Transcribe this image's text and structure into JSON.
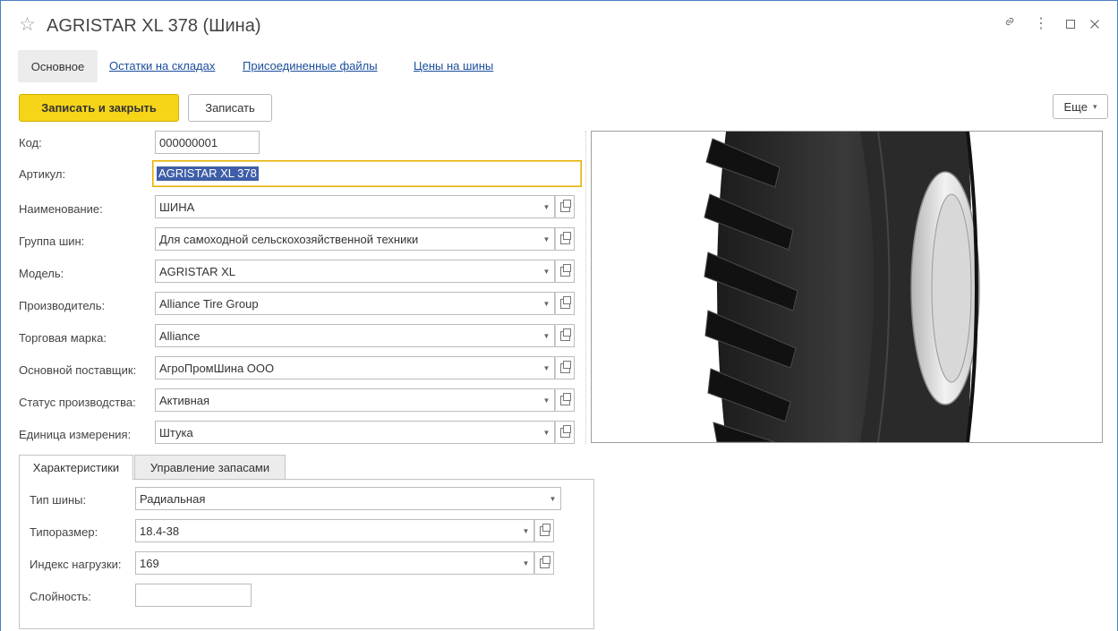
{
  "window": {
    "title": "AGRISTAR XL 378 (Шина)",
    "star_icon": "star-outline-icon",
    "controls": [
      "link-icon",
      "more-vertical-icon",
      "maximize-icon",
      "close-icon"
    ]
  },
  "tabs": {
    "main": "Основное",
    "stock": "Остатки на складах",
    "files": "Присоединенные файлы",
    "prices": "Цены на шины"
  },
  "toolbar": {
    "save_close": "Записать и закрыть",
    "save": "Записать",
    "more": "Еще",
    "more_arrow": "▾"
  },
  "form": {
    "code": {
      "label": "Код:",
      "value": "000000001"
    },
    "article": {
      "label": "Артикул:",
      "value": "AGRISTAR XL 378"
    },
    "name": {
      "label": "Наименование:",
      "value": "ШИНА"
    },
    "group": {
      "label": "Группа шин:",
      "value": "Для самоходной сельскохозяйственной техники"
    },
    "model": {
      "label": "Модель:",
      "value": "AGRISTAR XL"
    },
    "manufacturer": {
      "label": "Производитель:",
      "value": "Alliance Tire Group"
    },
    "brand": {
      "label": "Торговая марка:",
      "value": "Alliance"
    },
    "supplier": {
      "label": "Основной поставщик:",
      "value": "АгроПромШина ООО"
    },
    "status": {
      "label": "Статус производства:",
      "value": "Активная"
    },
    "unit": {
      "label": "Единица измерения:",
      "value": "Штука"
    }
  },
  "lower_tabs": {
    "characteristics": "Характеристики",
    "stock_management": "Управление запасами"
  },
  "characteristics": {
    "tire_type": {
      "label": "Тип шины:",
      "value": "Радиальная"
    },
    "size": {
      "label": "Типоразмер:",
      "value": "18.4-38"
    },
    "load_index": {
      "label": "Индекс нагрузки:",
      "value": "169"
    },
    "ply": {
      "label": "Слойность:",
      "value": ""
    }
  },
  "icons": {
    "dropdown": "dropdown-arrow-icon",
    "open": "open-item-icon"
  },
  "colors": {
    "primary_button": "#f6d518",
    "link": "#1a4d9c",
    "selection": "#3f5ea8",
    "window_border": "#4a7fc1"
  }
}
